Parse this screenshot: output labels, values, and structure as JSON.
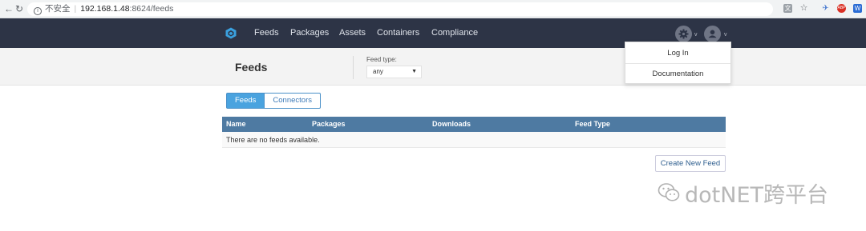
{
  "browser": {
    "insecure_label": "不安全",
    "url_host": "192.168.1.48",
    "url_path": ":8624/feeds"
  },
  "navbar": {
    "items": [
      {
        "label": "Feeds"
      },
      {
        "label": "Packages"
      },
      {
        "label": "Assets"
      },
      {
        "label": "Containers"
      },
      {
        "label": "Compliance"
      }
    ]
  },
  "header": {
    "title": "Feeds",
    "feed_type_label": "Feed type:",
    "feed_type_value": "any"
  },
  "user_menu": {
    "items": [
      {
        "label": "Log In"
      },
      {
        "label": "Documentation"
      }
    ]
  },
  "tabs": [
    {
      "label": "Feeds",
      "active": true
    },
    {
      "label": "Connectors",
      "active": false
    }
  ],
  "table": {
    "columns": [
      "Name",
      "Packages",
      "Downloads",
      "Feed Type"
    ],
    "empty_message": "There are no feeds available."
  },
  "actions": {
    "create_label": "Create New Feed"
  },
  "watermark": {
    "text": "dotNET跨平台"
  },
  "colors": {
    "navbar_bg": "#2d3446",
    "table_header_bg": "#4e7aa2",
    "tab_active_bg": "#4aa3df"
  }
}
